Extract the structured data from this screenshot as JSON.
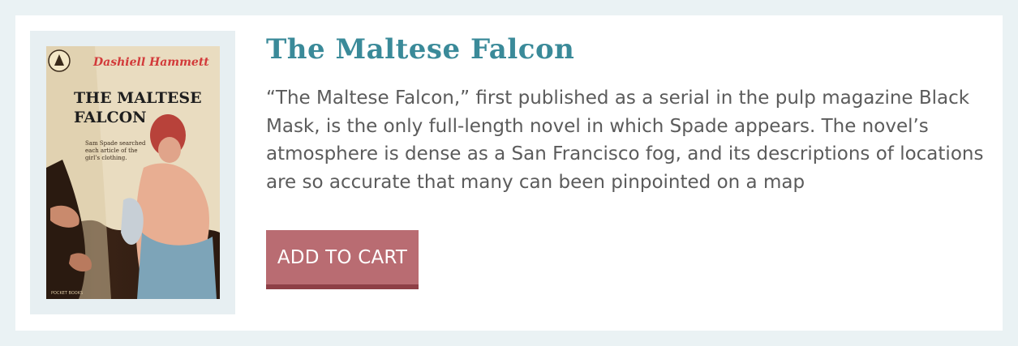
{
  "product": {
    "title": "The Maltese Falcon",
    "description": "“The Maltese Falcon,” first published as a serial in the pulp magazine Black Mask, is the only full-length novel in which Spade appears. The novel’s atmosphere is dense as a San Francisco fog, and its descriptions of locations are so accurate that many can been pinpointed on a map",
    "add_to_cart_label": "ADD TO CART"
  },
  "cover": {
    "author": "Dashiell Hammett",
    "title_line1": "THE MALTESE",
    "title_line2": "FALCON",
    "blurb_line1": "Sam Spade searched",
    "blurb_line2": "each article of the",
    "blurb_line3": "girl’s clothing.",
    "publisher_mark": "POCKET BOOKS"
  },
  "colors": {
    "page_background": "#eaf2f4",
    "title": "#3a8a99",
    "body_text": "#5b5b5b",
    "button": "#b96c72",
    "button_shadow": "#8e3f46",
    "cover_author": "#d23a3a"
  }
}
